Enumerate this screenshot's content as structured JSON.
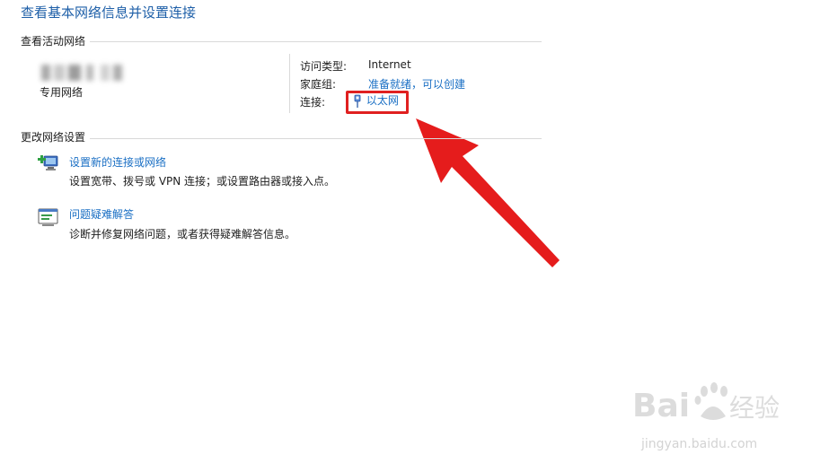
{
  "page_title": "查看基本网络信息并设置连接",
  "active_networks": {
    "heading": "查看活动网络",
    "network_type": "专用网络",
    "access_type_label": "访问类型:",
    "access_type_value": "Internet",
    "homegroup_label": "家庭组:",
    "homegroup_value": "准备就绪，可以创建",
    "connections_label": "连接:",
    "connections_value": "以太网"
  },
  "change_settings": {
    "heading": "更改网络设置",
    "items": [
      {
        "title": "设置新的连接或网络",
        "description": "设置宽带、拨号或 VPN 连接；或设置路由器或接入点。",
        "icon": "new-connection-icon"
      },
      {
        "title": "问题疑难解答",
        "description": "诊断并修复网络问题，或者获得疑难解答信息。",
        "icon": "troubleshoot-icon"
      }
    ]
  },
  "watermark": {
    "brand": "Baidu经验",
    "url": "jingyan.baidu.com"
  },
  "colors": {
    "link": "#1a6fc4",
    "title": "#1e5fa8",
    "highlight": "#e02020"
  }
}
